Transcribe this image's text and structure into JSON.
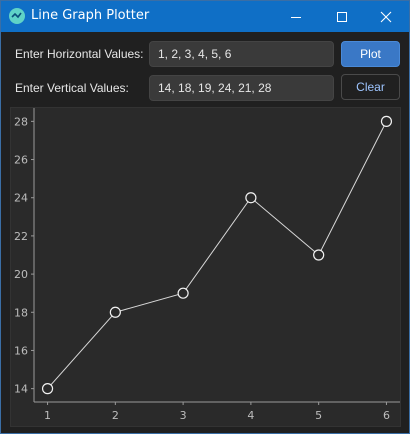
{
  "window": {
    "title": "Line Graph Plotter",
    "accent": "#0f6fc6",
    "minimize_icon": "minimize-icon",
    "maximize_icon": "maximize-icon",
    "close_icon": "close-icon"
  },
  "form": {
    "x_label": "Enter Horizontal Values:",
    "x_value": "1, 2, 3, 4, 5, 6",
    "y_label": "Enter Vertical Values:",
    "y_value": "14, 18, 19, 24, 21, 28",
    "plot_label": "Plot",
    "clear_label": "Clear"
  },
  "chart_data": {
    "type": "line",
    "x": [
      1,
      2,
      3,
      4,
      5,
      6
    ],
    "y": [
      14,
      18,
      19,
      24,
      21,
      28
    ],
    "xticks": [
      1,
      2,
      3,
      4,
      5,
      6
    ],
    "yticks": [
      14,
      16,
      18,
      20,
      22,
      24,
      26,
      28
    ],
    "xlim": [
      0.8,
      6.2
    ],
    "ylim": [
      13.3,
      28.7
    ],
    "title": "",
    "xlabel": "",
    "ylabel": "",
    "grid": false,
    "line_color": "#d8d8d8",
    "marker": "circle"
  }
}
